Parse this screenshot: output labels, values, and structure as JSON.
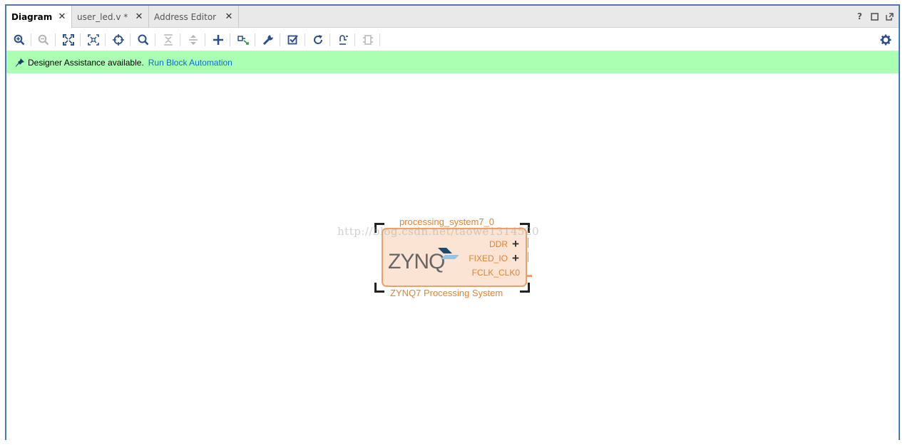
{
  "tabs": [
    {
      "label": "Diagram",
      "active": true
    },
    {
      "label": "user_led.v *",
      "active": false
    },
    {
      "label": "Address Editor",
      "active": false
    }
  ],
  "window_controls": {
    "help": "?",
    "maximize": "□",
    "float": "⧉"
  },
  "toolbar": {
    "icons": [
      "zoom-in-icon",
      "zoom-out-icon",
      "fit-view-icon",
      "fit-selection-icon",
      "auto-connect-icon",
      "search-icon",
      "collapse-all-icon",
      "expand-all-icon",
      "add-ip-icon",
      "make-connection-icon",
      "properties-wrench-icon",
      "validate-design-icon",
      "regenerate-layout-icon",
      "create-port-icon",
      "disabled-module-icon",
      "settings-gear-icon"
    ]
  },
  "banner": {
    "message": "Designer Assistance available.",
    "link": "Run Block Automation",
    "background": "#aaffb3"
  },
  "canvas": {
    "block": {
      "instance_name": "processing_system7_0",
      "logo_text": "ZYNQ",
      "subtitle": "ZYNQ7 Processing System",
      "ports": [
        {
          "name": "DDR",
          "expandable": "+"
        },
        {
          "name": "FIXED_IO",
          "expandable": "+"
        },
        {
          "name": "FCLK_CLK0",
          "expandable": ""
        }
      ],
      "accent_color": "#e6822e"
    },
    "watermark": "http://blog.csdn.net/taowe1314520"
  }
}
